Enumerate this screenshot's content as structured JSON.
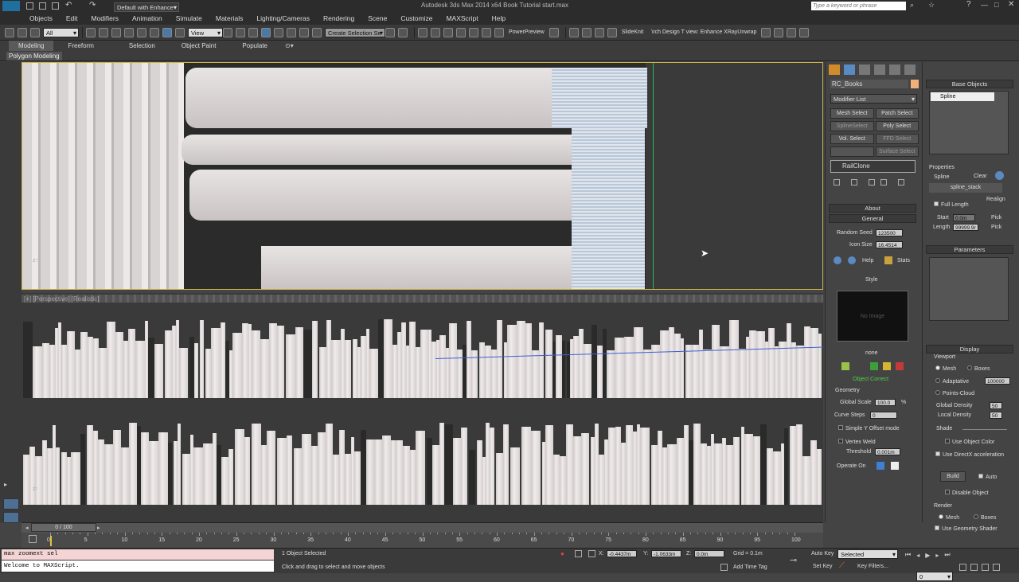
{
  "title": {
    "workspace": "Default with Enhance",
    "app_title": "Autodesk 3ds Max  2014 x64      Book Tutorial start.max",
    "search_placeholder": "Type a keyword or phrase"
  },
  "menu": [
    "Objects",
    "Edit",
    "Modifiers",
    "Animation",
    "Simulate",
    "Materials",
    "Lighting/Cameras",
    "Rendering",
    "Scene",
    "Customize",
    "MAXScript",
    "Help"
  ],
  "toolbar": {
    "filter": "All",
    "ref_coord": "View",
    "selection_set": "Create Selection Se",
    "power_preview": "PowerPreview",
    "slide_knit": "SlideKnit",
    "arch_design": "\\rch  Design T view: Enhance  XRayUnwrap"
  },
  "ribbon": {
    "tabs": [
      "Modeling",
      "Freeform",
      "Selection",
      "Object Paint",
      "Populate"
    ],
    "sub": "Polygon Modeling"
  },
  "viewports": {
    "top_label": "[+] [Perspective] [Realistic]",
    "bottom_label": "[+] [Perspective] [Realistic]"
  },
  "command_panel": {
    "object_name": "RC_Books",
    "modifier_list": "Modifier List",
    "modifier_buttons": [
      "Mesh Select",
      "Patch Select",
      "SplineSelect",
      "Poly Select",
      "Vol. Select",
      "FFD Select",
      "",
      "Surface Select"
    ],
    "stack_item": "RailClone",
    "about": "About",
    "general": "General",
    "random_seed_label": "Random Seed",
    "random_seed": "123500",
    "icon_size_label": "Icon Size",
    "icon_size": "16.4514",
    "help": "Help",
    "stats": "Stats",
    "style": "Style",
    "no_image": "No Image",
    "style_name": "none",
    "object_correct": "Object Correct",
    "geometry": "Geometry",
    "global_scale_label": "Global Scale",
    "global_scale": "100.0",
    "percent": "%",
    "curve_steps_label": "Curve Steps",
    "curve_steps": "0",
    "simple_y_offset": "Simple Y Offset mode",
    "vertex_weld": "Vertex Weld",
    "threshold_label": "Threshold",
    "threshold": "0.001m",
    "operate_on": "Operate On"
  },
  "rc_panel": {
    "base_objects": "Base Objects",
    "spline_item": "Spline",
    "properties": "Properties",
    "spline_label": "Spline",
    "clear": "Clear",
    "spline_stack": "spline_stack",
    "realign": "Realign",
    "full_length": "Full Length",
    "start_label": "Start",
    "start": "0.0m",
    "length_label": "Length",
    "length": "99999.9r",
    "pick": "Pick",
    "parameters": "Parameters",
    "display": "Display",
    "viewport": "Viewport",
    "mesh": "Mesh",
    "boxes": "Boxes",
    "adaptative": "Adaptative",
    "adaptative_val": "100000",
    "points_cloud": "Points-Cloud",
    "global_density_label": "Global Density",
    "global_density": "50",
    "local_density_label": "Local Density",
    "local_density": "50",
    "shade": "Shade",
    "use_object_color": "Use Object Color",
    "use_directx": "Use DirectX acceleration",
    "build": "Build",
    "auto": "Auto",
    "disable_object": "Disable Object",
    "render": "Render",
    "use_geometry_shader": "Use Geometry Shader"
  },
  "timeline": {
    "frame": "0 / 100",
    "ticks": [
      "0",
      "5",
      "10",
      "15",
      "20",
      "25",
      "30",
      "35",
      "40",
      "45",
      "50",
      "55",
      "60",
      "65",
      "70",
      "75",
      "80",
      "85",
      "90",
      "95",
      "100"
    ]
  },
  "status": {
    "maxscript_listener": "max zoomext sel",
    "maxscript_output": "Welcome to MAXScript.",
    "selected": "1 Object Selected",
    "prompt": "Click and drag to select and move objects",
    "x_label": "X:",
    "x": "-0.4437m",
    "y_label": "Y:",
    "y": "-1.0633m",
    "z_label": "Z:",
    "z": "0.0m",
    "grid": "Grid = 0.1m",
    "add_time_tag": "Add Time Tag",
    "auto_key": "Auto Key",
    "selected_dd": "Selected",
    "set_key": "Set Key",
    "key_filters": "Key Filters...",
    "frame_field": "0"
  }
}
